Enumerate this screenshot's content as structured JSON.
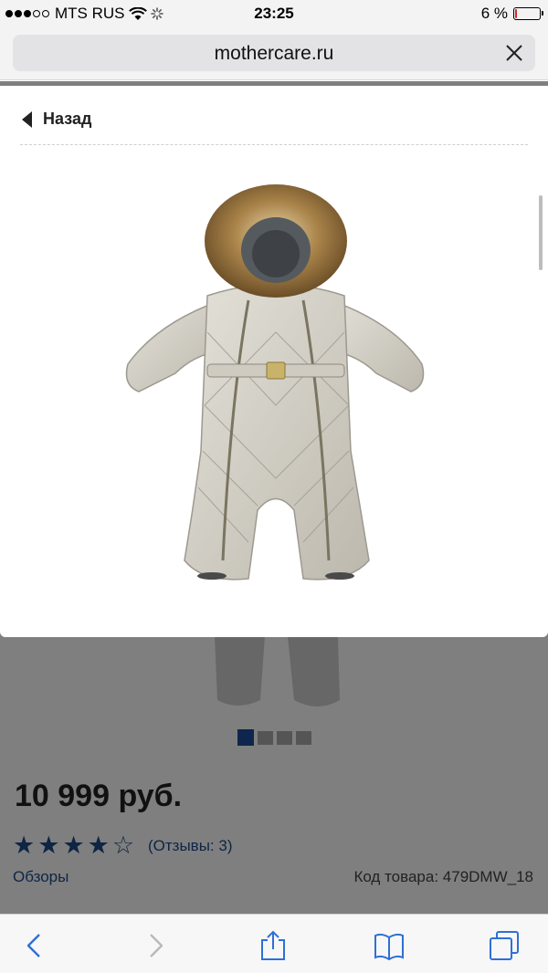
{
  "status": {
    "carrier": "MTS RUS",
    "time": "23:25",
    "battery": "6 %",
    "battery_level": 0.06
  },
  "browser": {
    "url": "mothercare.ru"
  },
  "modal": {
    "back_label": "Назад"
  },
  "product": {
    "price": "10 999 руб.",
    "rating": 4,
    "rating_max": 5,
    "reviews": "(Отзывы: 3)",
    "overviews": "Обзоры",
    "sku": "Код товара: 479DMW_18",
    "image_count": 4,
    "image_active": 1
  },
  "colors": {
    "accent": "#1f4a8a",
    "toolbar_icon": "#2f6fd6"
  }
}
